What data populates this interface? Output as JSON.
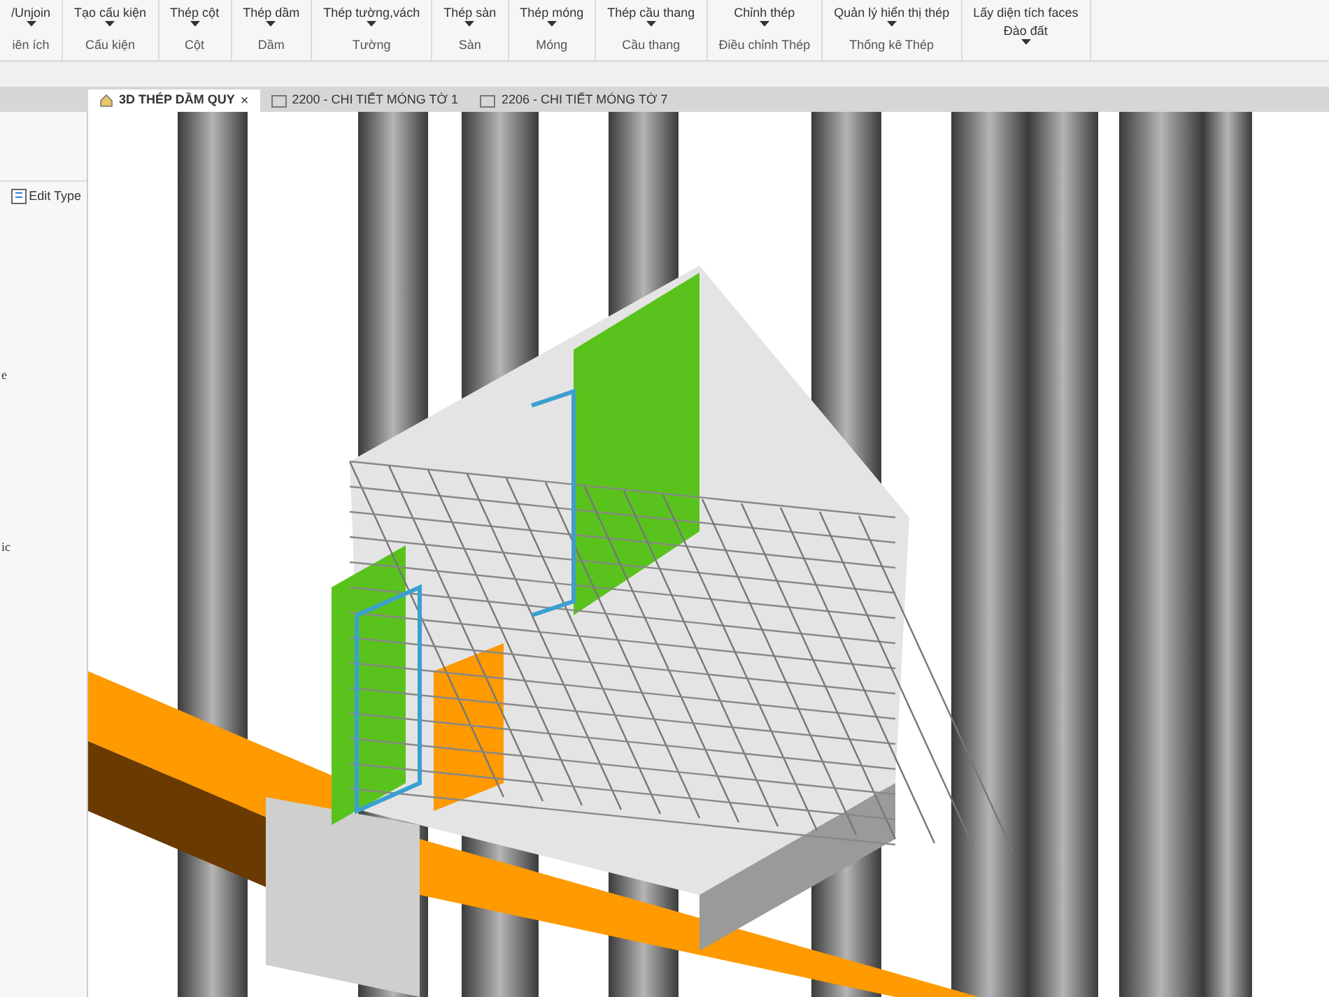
{
  "ribbon": {
    "groups": [
      {
        "items": [
          {
            "label": "/Unjoin",
            "dropdown": true
          }
        ],
        "label": "iên ích"
      },
      {
        "items": [
          {
            "label": "Tạo cấu kiện",
            "dropdown": true
          }
        ],
        "label": "Cấu kiện"
      },
      {
        "items": [
          {
            "label": "Thép cột",
            "dropdown": true
          }
        ],
        "label": "Cột"
      },
      {
        "items": [
          {
            "label": "Thép dầm",
            "dropdown": true
          }
        ],
        "label": "Dầm"
      },
      {
        "items": [
          {
            "label": "Thép tường,vách",
            "dropdown": true
          }
        ],
        "label": "Tường"
      },
      {
        "items": [
          {
            "label": "Thép sàn",
            "dropdown": true
          }
        ],
        "label": "Sàn"
      },
      {
        "items": [
          {
            "label": "Thép móng",
            "dropdown": true
          }
        ],
        "label": "Móng"
      },
      {
        "items": [
          {
            "label": "Thép cầu thang",
            "dropdown": true
          }
        ],
        "label": "Cầu thang"
      },
      {
        "items": [
          {
            "label": "Chỉnh thép",
            "dropdown": true
          }
        ],
        "label": "Điều chỉnh Thép"
      },
      {
        "items": [
          {
            "label": "Quản lý hiển thị thép",
            "dropdown": true
          }
        ],
        "label": "Thống kê Thép"
      },
      {
        "items": [
          {
            "label": "Lấy diện tích faces",
            "dropdown": false
          },
          {
            "label": "Đào đất",
            "dropdown": true
          }
        ]
      }
    ]
  },
  "tabs": [
    {
      "label": "3D THÉP DẦM QUY",
      "kind": "model",
      "selected": true,
      "close": "×"
    },
    {
      "label": "2200 - CHI TIẾT MÓNG TỜ 1",
      "kind": "sheet",
      "selected": false
    },
    {
      "label": "2206 - CHI TIẾT MÓNG TỜ 7",
      "kind": "sheet",
      "selected": false
    }
  ],
  "properties": {
    "edit_type": "Edit Type",
    "rows": [
      "e",
      "ic"
    ]
  }
}
